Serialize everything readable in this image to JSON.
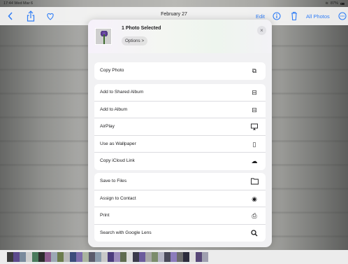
{
  "status_bar": {
    "time": "17:44",
    "date": "Wed Mar 6",
    "battery": "87%"
  },
  "nav": {
    "title": "February 27",
    "edit_label": "Edit",
    "all_photos_label": "All Photos",
    "icons": {
      "back": "chevron-left-icon",
      "share": "share-icon",
      "favorite": "heart-icon",
      "info": "info-icon",
      "delete": "trash-icon",
      "more": "ellipsis-icon"
    }
  },
  "sheet": {
    "title": "1 Photo Selected",
    "options_label": "Options >",
    "close_symbol": "×",
    "groups": [
      [
        {
          "label": "Copy Photo",
          "icon": "copy-photo-icon",
          "glyph": "⧉"
        }
      ],
      [
        {
          "label": "Add to Shared Album",
          "icon": "shared-album-icon",
          "glyph": "⊟"
        },
        {
          "label": "Add to Album",
          "icon": "add-album-icon",
          "glyph": "⊟"
        },
        {
          "label": "AirPlay",
          "icon": "airplay-icon",
          "glyph": "▭"
        },
        {
          "label": "Use as Wallpaper",
          "icon": "wallpaper-icon",
          "glyph": "▯"
        },
        {
          "label": "Copy iCloud Link",
          "icon": "icloud-link-icon",
          "glyph": "☁"
        }
      ],
      [
        {
          "label": "Save to Files",
          "icon": "folder-icon",
          "glyph": "▭"
        },
        {
          "label": "Assign to Contact",
          "icon": "contact-icon",
          "glyph": "◉"
        },
        {
          "label": "Print",
          "icon": "printer-icon",
          "glyph": "⎙"
        },
        {
          "label": "Search with Google Lens",
          "icon": "search-icon",
          "glyph": "⚲"
        }
      ]
    ]
  },
  "thumbnail_strip_colors": [
    "#3b3b3b",
    "#5c4a8c",
    "#7a8a9c",
    "#cfcfcf",
    "#4a7a5c",
    "#2c2c2c",
    "#8c5c8c",
    "#9ca8b4",
    "#6c7c4c",
    "#b8b8b8",
    "#3c4c7c",
    "#7c6cac",
    "#aab4a0",
    "#5c5c6c",
    "#8c9cac",
    "#c8c8c8",
    "#4c3c7c",
    "#9c8cbc",
    "#606c50",
    "#dcdcdc",
    "#3a3a4a",
    "#6c5c9c",
    "#a8a8a8",
    "#7c8c6c",
    "#b4b4c4",
    "#484858",
    "#8c7cbc",
    "#6c6c6c",
    "#2c2c3c",
    "#e0e0e0",
    "#584878",
    "#a0a0b0"
  ]
}
